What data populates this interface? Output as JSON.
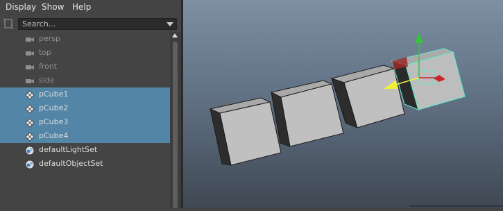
{
  "menu": {
    "items": [
      {
        "label": "Display"
      },
      {
        "label": "Show"
      },
      {
        "label": "Help"
      }
    ]
  },
  "search": {
    "placeholder": "Search..."
  },
  "outliner": {
    "items": [
      {
        "label": "persp",
        "icon": "camera-icon",
        "dimmed": true,
        "selected": false
      },
      {
        "label": "top",
        "icon": "camera-icon",
        "dimmed": true,
        "selected": false
      },
      {
        "label": "front",
        "icon": "camera-icon",
        "dimmed": true,
        "selected": false
      },
      {
        "label": "side",
        "icon": "camera-icon",
        "dimmed": true,
        "selected": false
      },
      {
        "label": "pCube1",
        "icon": "mesh-icon",
        "dimmed": false,
        "selected": true
      },
      {
        "label": "pCube2",
        "icon": "mesh-icon",
        "dimmed": false,
        "selected": true
      },
      {
        "label": "pCube3",
        "icon": "mesh-icon",
        "dimmed": false,
        "selected": true
      },
      {
        "label": "pCube4",
        "icon": "mesh-icon",
        "dimmed": false,
        "selected": true
      },
      {
        "label": "defaultLightSet",
        "icon": "set-icon",
        "dimmed": false,
        "selected": false
      },
      {
        "label": "defaultObjectSet",
        "icon": "set-icon",
        "dimmed": false,
        "selected": false
      }
    ]
  },
  "colors": {
    "panel_bg": "#444444",
    "selection": "#5285a6",
    "viewport_top": "#7e8fa3",
    "viewport_bottom": "#3f4853",
    "cube_face": "#bdbdbd",
    "cube_side": "#333333",
    "active_wire": "#67e8c9",
    "manip_x": "#c8282d",
    "manip_y": "#35c43a",
    "manip_z": "#f0f038"
  }
}
